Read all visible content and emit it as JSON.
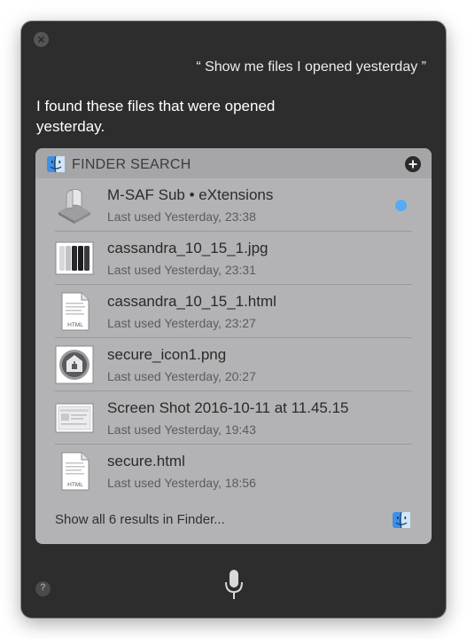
{
  "query": "“ Show me files I opened yesterday ”",
  "answer": "I found these files that were opened yesterday.",
  "panel": {
    "title": "FINDER SEARCH",
    "icon": "finder-icon",
    "add_icon": "plus-icon",
    "results": [
      {
        "name": "M-SAF Sub • eXtensions",
        "meta": "Last used Yesterday, 23:38",
        "icon": "script-editor-icon",
        "unread": true
      },
      {
        "name": "cassandra_10_15_1.jpg",
        "meta": "Last used Yesterday, 23:31",
        "icon": "jpg-thumbnail-icon"
      },
      {
        "name": "cassandra_10_15_1.html",
        "meta": "Last used Yesterday, 23:27",
        "icon": "html-file-icon"
      },
      {
        "name": "secure_icon1.png",
        "meta": "Last used Yesterday, 20:27",
        "icon": "png-thumbnail-icon"
      },
      {
        "name": "Screen Shot 2016-10-11 at 11.45.15",
        "meta": "Last used Yesterday, 19:43",
        "icon": "screenshot-thumbnail-icon"
      },
      {
        "name": "secure.html",
        "meta": "Last used Yesterday, 18:56",
        "icon": "html-file-icon"
      }
    ],
    "show_all": "Show all 6 results in Finder..."
  },
  "controls": {
    "close_icon": "close-icon",
    "mic_icon": "microphone-icon",
    "help_label": "?"
  },
  "colors": {
    "window_bg": "#2d2d2e",
    "panel_bg": "#b3b3b5",
    "unread_dot": "#57aaf5"
  }
}
